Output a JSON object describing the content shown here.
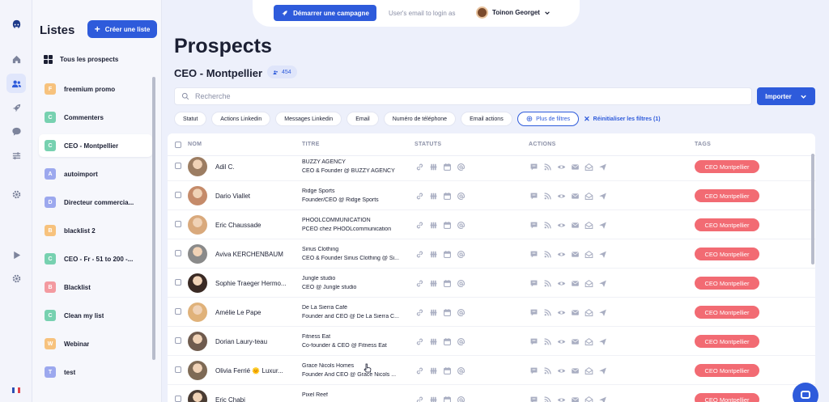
{
  "app": {
    "start_campaign_label": "Démarrer une campagne",
    "login_hint": "User's email to login as",
    "user_name": "Toinon Georget"
  },
  "rail": {
    "icons": [
      "logo-icon",
      "home-icon",
      "users-icon",
      "rocket-icon",
      "chat-icon",
      "filter-icon",
      "settings-icon",
      "play-icon",
      "settings-icon"
    ]
  },
  "lists_panel": {
    "title": "Listes",
    "create_label": "Créer une liste",
    "all_label": "Tous les prospects",
    "items": [
      {
        "letter": "F",
        "label": "freemium promo",
        "color": "#f7c27d"
      },
      {
        "letter": "C",
        "label": "Commenters",
        "color": "#77d1b0"
      },
      {
        "letter": "C",
        "label": "CEO - Montpellier",
        "color": "#77d1b0",
        "active": true
      },
      {
        "letter": "A",
        "label": "autoimport",
        "color": "#9ca8ee"
      },
      {
        "letter": "D",
        "label": "Directeur commercia...",
        "color": "#9ca8ee"
      },
      {
        "letter": "B",
        "label": "blacklist 2",
        "color": "#f7c27d"
      },
      {
        "letter": "C",
        "label": "CEO - Fr - 51 to 200 -...",
        "color": "#77d1b0"
      },
      {
        "letter": "B",
        "label": "Blacklist",
        "color": "#f39aa0"
      },
      {
        "letter": "C",
        "label": "Clean my list",
        "color": "#77d1b0"
      },
      {
        "letter": "W",
        "label": "Webinar",
        "color": "#f7c27d"
      },
      {
        "letter": "T",
        "label": "test",
        "color": "#9ca8ee"
      }
    ]
  },
  "main": {
    "title": "Prospects",
    "list_name": "CEO - Montpellier",
    "count": "454",
    "search_placeholder": "Recherche",
    "import_label": "Importer",
    "filters": [
      "Statut",
      "Actions Linkedin",
      "Messages Linkedin",
      "Email",
      "Numéro de téléphone",
      "Email actions"
    ],
    "more_filters_label": "Plus de filtres",
    "reset_label": "Réinitialiser les filtres (1)"
  },
  "table": {
    "headers": {
      "name": "NOM",
      "title": "TITRE",
      "status": "STATUTS",
      "actions": "ACTIONS",
      "tags": "TAGS"
    },
    "rows": [
      {
        "name": "Adil C.",
        "company": "BUZZY AGENCY",
        "role": "CEO & Founder @ BUZZY AGENCY",
        "tag": "CEO Montpellier",
        "avatar_color": "#9c7d62"
      },
      {
        "name": "Dario Viallet",
        "company": "Ridge Sports",
        "role": "Founder/CEO @ Ridge Sports",
        "tag": "CEO Montpellier",
        "avatar_color": "#c58b6a"
      },
      {
        "name": "Eric Chaussade",
        "company": "PHOOLCOMMUNICATION",
        "role": "PCEO chez PHOOLcommunication",
        "tag": "CEO Montpellier",
        "avatar_color": "#d9a97c"
      },
      {
        "name": "Aviva KERCHENBAUM",
        "company": "Sirius Clothing",
        "role": "CEO & Founder Sirius Clothing @ Si...",
        "tag": "CEO Montpellier",
        "avatar_color": "#8a8a8a"
      },
      {
        "name": "Sophie Traeger Hermo...",
        "company": "Jungle studio",
        "role": "CEO @ Jungle studio",
        "tag": "CEO Montpellier",
        "avatar_color": "#3a2a24"
      },
      {
        "name": "Amélie Le Pape",
        "company": "De La Sierra Café",
        "role": "Founder and CEO @ De La Sierra C...",
        "tag": "CEO Montpellier",
        "avatar_color": "#e0b27a"
      },
      {
        "name": "Dorian Laury-teau",
        "company": "Fitness Eat",
        "role": "Co-founder & CEO @ Fitness Eat",
        "tag": "CEO Montpellier",
        "avatar_color": "#6f5b4e"
      },
      {
        "name": "Olivia Ferrié 🌞 Luxur...",
        "company": "Grace Nicols Homes",
        "role": "Founder And CEO @ Grace Nicols ...",
        "tag": "CEO Montpellier",
        "avatar_color": "#7e6a55"
      },
      {
        "name": "Eric Chabi",
        "company": "Pixel Reef",
        "role": "",
        "tag": "CEO Montpellier",
        "avatar_color": "#4a3c33"
      }
    ],
    "status_icons": [
      "link-icon",
      "linkedin-action-icon",
      "calendar-icon",
      "at-icon"
    ],
    "action_icons": [
      "message-icon",
      "rss-icon",
      "eye-icon",
      "mail-icon",
      "open-mail-icon",
      "send-icon"
    ]
  },
  "colors": {
    "accent": "#2e5bdb",
    "tag": "#f26b73",
    "background": "#edf0fb"
  }
}
